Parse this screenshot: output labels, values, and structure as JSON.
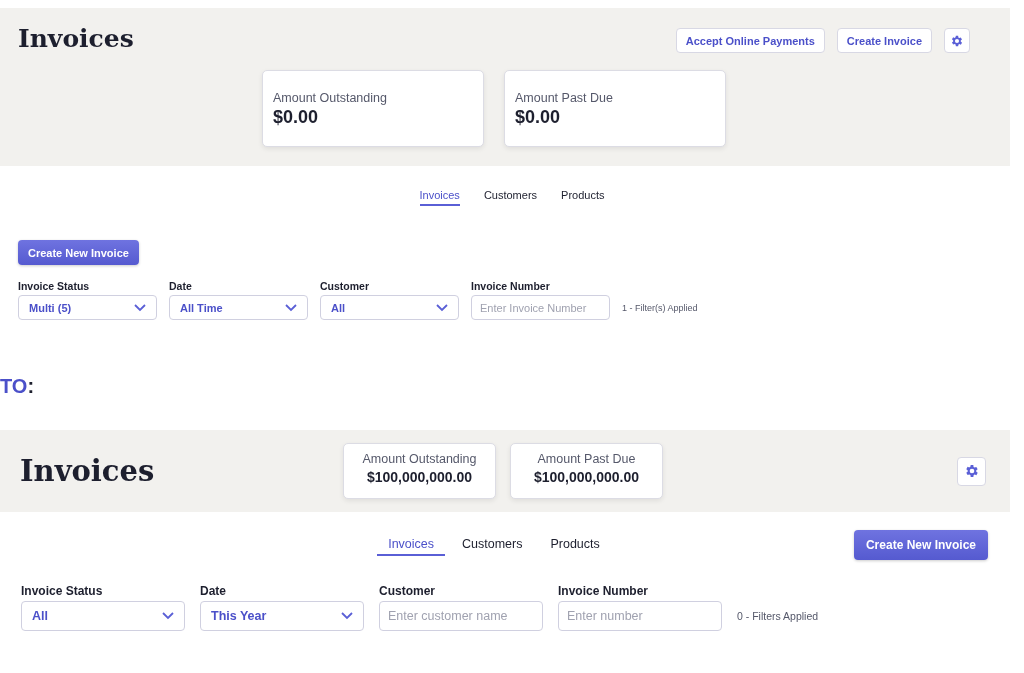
{
  "mockups": [
    {
      "kind": "stacked",
      "title": "Invoices",
      "header_buttons": [
        "Accept Online Payments",
        "Create Invoice"
      ],
      "stat_cards": [
        {
          "label": "Amount Outstanding",
          "value": "$0.00"
        },
        {
          "label": "Amount Past Due",
          "value": "$0.00"
        }
      ],
      "tabs": [
        {
          "label": "Invoices",
          "selected": true
        },
        {
          "label": "Customers",
          "selected": false
        },
        {
          "label": "Products",
          "selected": false
        }
      ],
      "create_button": "Create New Invoice",
      "filters": [
        {
          "kind": "select",
          "label": "Invoice Status",
          "value": "Multi (5)"
        },
        {
          "kind": "select",
          "label": "Date",
          "value": "All Time"
        },
        {
          "kind": "select",
          "label": "Customer",
          "value": "All"
        },
        {
          "kind": "input",
          "label": "Invoice Number",
          "placeholder": "Enter Invoice Number"
        }
      ],
      "filters_applied": "1 - Filter(s) Applied"
    },
    {
      "kind": "inline",
      "title": "Invoices",
      "stat_cards": [
        {
          "label": "Amount Outstanding",
          "value": "$100,000,000.00"
        },
        {
          "label": "Amount Past Due",
          "value": "$100,000,000.00"
        }
      ],
      "tabs": [
        {
          "label": "Invoices",
          "selected": true
        },
        {
          "label": "Customers",
          "selected": false
        },
        {
          "label": "Products",
          "selected": false
        }
      ],
      "create_button": "Create New Invoice",
      "filters": [
        {
          "kind": "select",
          "label": "Invoice Status",
          "value": "All"
        },
        {
          "kind": "select",
          "label": "Date",
          "value": "This Year"
        },
        {
          "kind": "input",
          "label": "Customer",
          "placeholder": "Enter customer name"
        },
        {
          "kind": "input",
          "label": "Invoice Number",
          "placeholder": "Enter number"
        }
      ],
      "filters_applied": "0 - Filters Applied"
    }
  ],
  "transition_label": {
    "word": "TO",
    "colon": ":"
  }
}
